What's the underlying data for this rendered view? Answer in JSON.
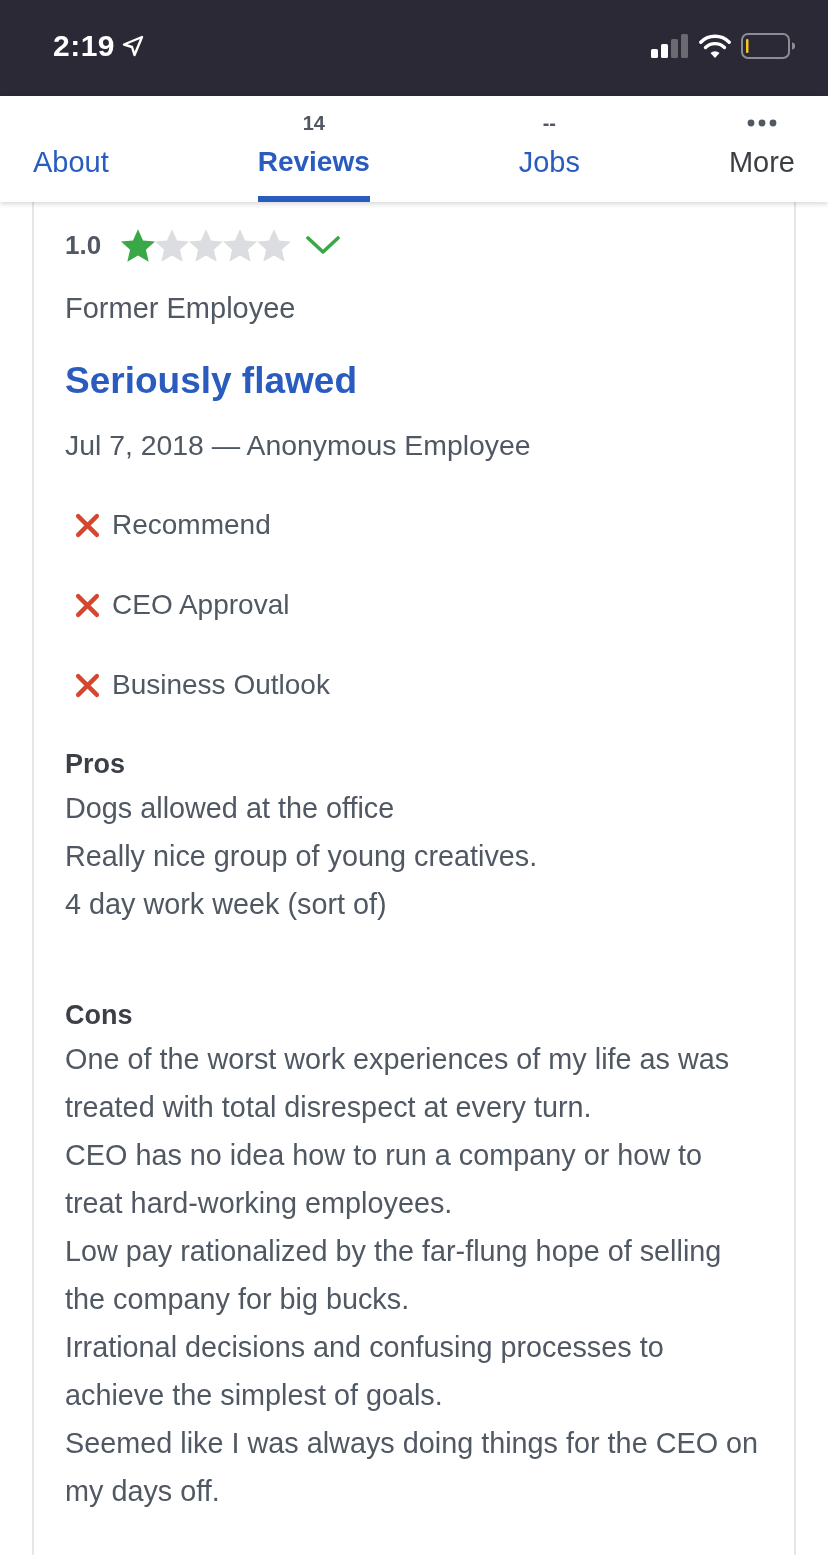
{
  "status_bar": {
    "time": "2:19"
  },
  "tabs": [
    {
      "kind": "tab",
      "label": "About",
      "selected": false
    },
    {
      "kind": "tab",
      "count": "14",
      "label": "Reviews",
      "selected": true
    },
    {
      "kind": "tab",
      "count": "--",
      "label": "Jobs",
      "selected": false
    },
    {
      "kind": "menu",
      "label": "More",
      "selected": false
    }
  ],
  "review": {
    "rating": "1.0",
    "stars": 1,
    "employee_status": "Former Employee",
    "title": "Seriously flawed",
    "byline": "Jul 7, 2018 — Anonymous Employee",
    "indicators": [
      {
        "label": "Recommend",
        "positive": false
      },
      {
        "label": "CEO Approval",
        "positive": false
      },
      {
        "label": "Business Outlook",
        "positive": false
      }
    ],
    "sections": [
      {
        "heading": "Pros",
        "lines": [
          "Dogs allowed at the office",
          "Really nice group of young creatives.",
          "4 day work week (sort of)"
        ]
      },
      {
        "heading": "Cons",
        "lines": [
          "One of the worst work experiences of my life as was treated with total disrespect at every turn.",
          "CEO has no idea how to run a company or how to treat hard-working employees.",
          "Low pay rationalized by the far-flung hope of selling the company for big bucks.",
          "Irrational decisions and confusing processes to achieve the simplest of goals.",
          "Seemed like I was always doing things for the CEO on my days off."
        ]
      }
    ]
  }
}
